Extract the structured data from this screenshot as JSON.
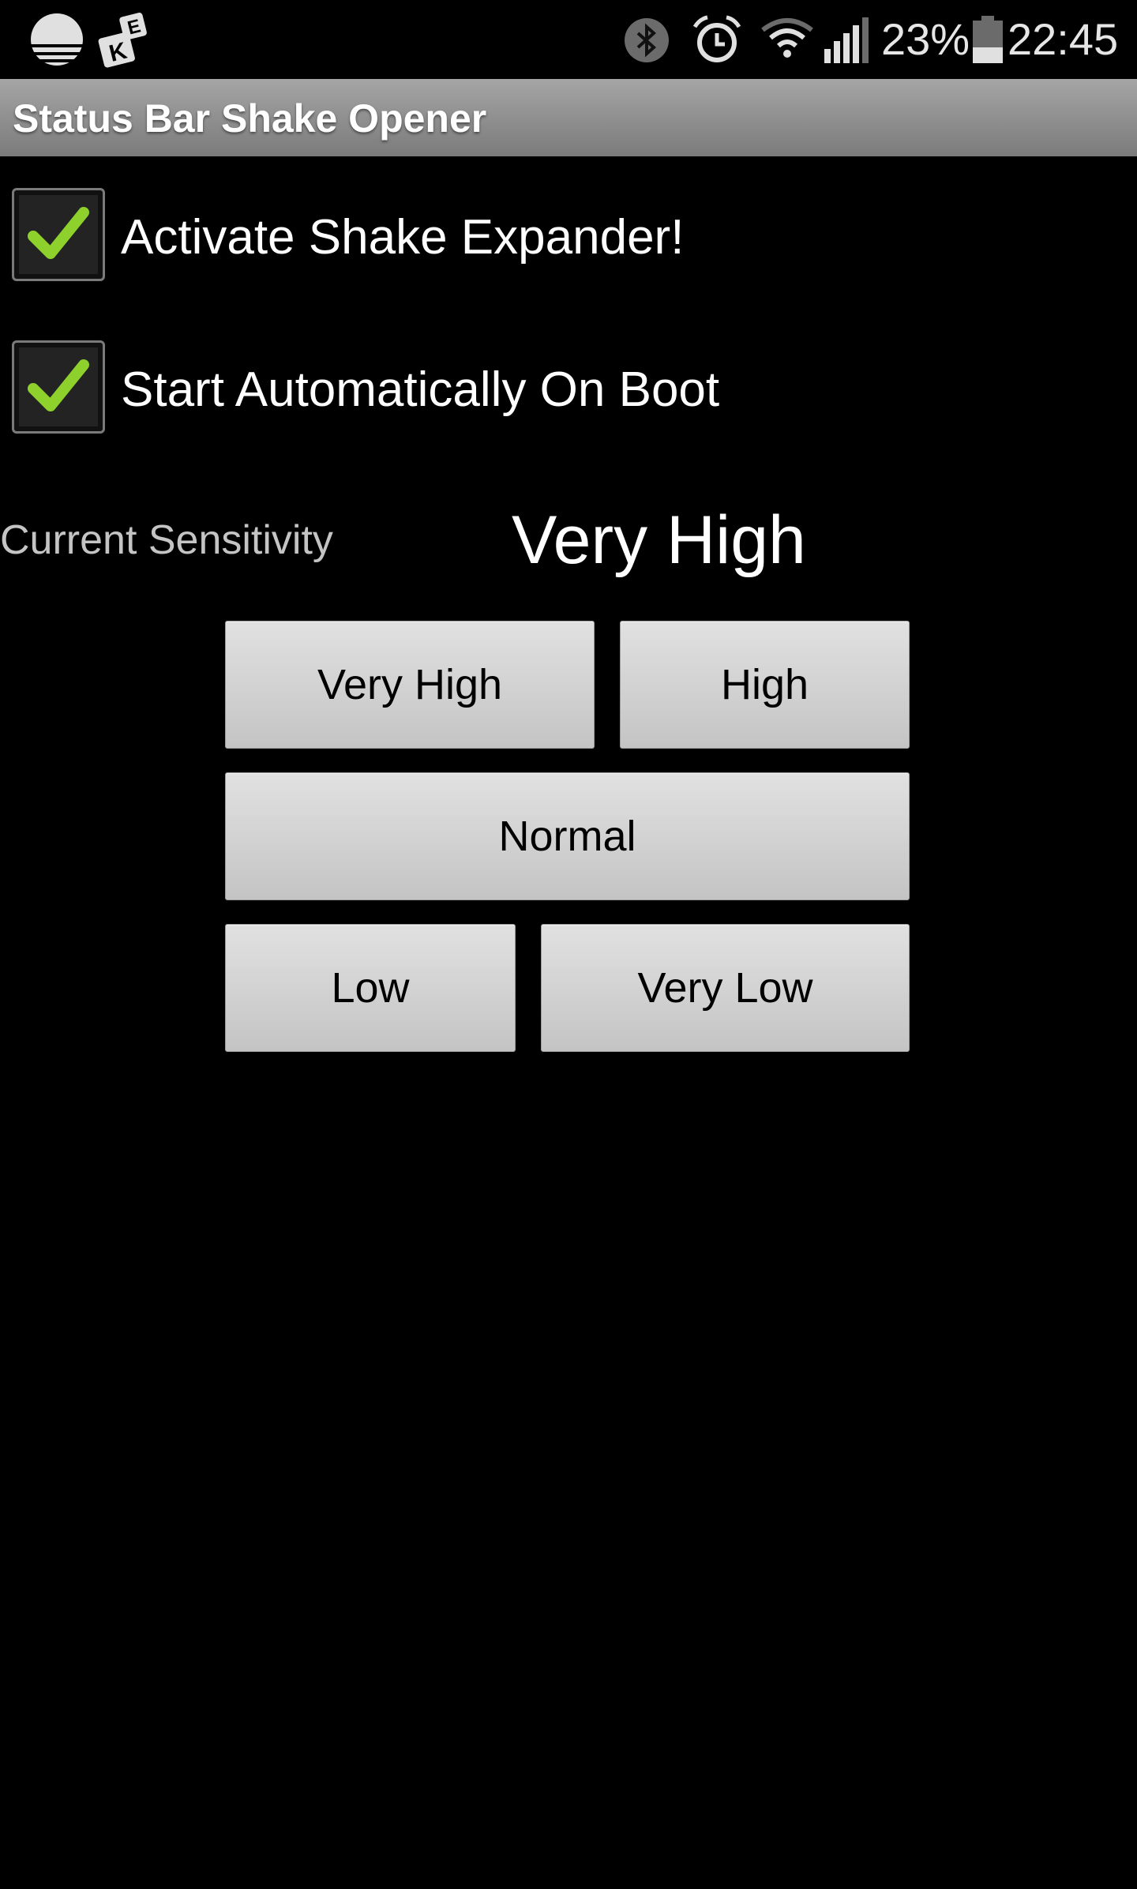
{
  "status_bar": {
    "left_icons": [
      "sunset-icon",
      "keyboard-ke-icon"
    ],
    "right_icons": [
      "bluetooth-icon",
      "alarm-icon",
      "wifi-icon",
      "signal-icon",
      "battery-icon"
    ],
    "battery_percent": "23%",
    "time": "22:45"
  },
  "action_bar": {
    "title": "Status Bar Shake Opener"
  },
  "settings": {
    "activate": {
      "label": "Activate Shake Expander!",
      "checked": true
    },
    "boot": {
      "label": "Start Automatically On Boot",
      "checked": true
    }
  },
  "sensitivity": {
    "label": "Current Sensitivity",
    "value": "Very High",
    "buttons": {
      "very_high": "Very High",
      "high": "High",
      "normal": "Normal",
      "low": "Low",
      "very_low": "Very Low"
    }
  },
  "colors": {
    "check": "#8ed12c",
    "background": "#000000",
    "button": "#d6d6d6"
  }
}
